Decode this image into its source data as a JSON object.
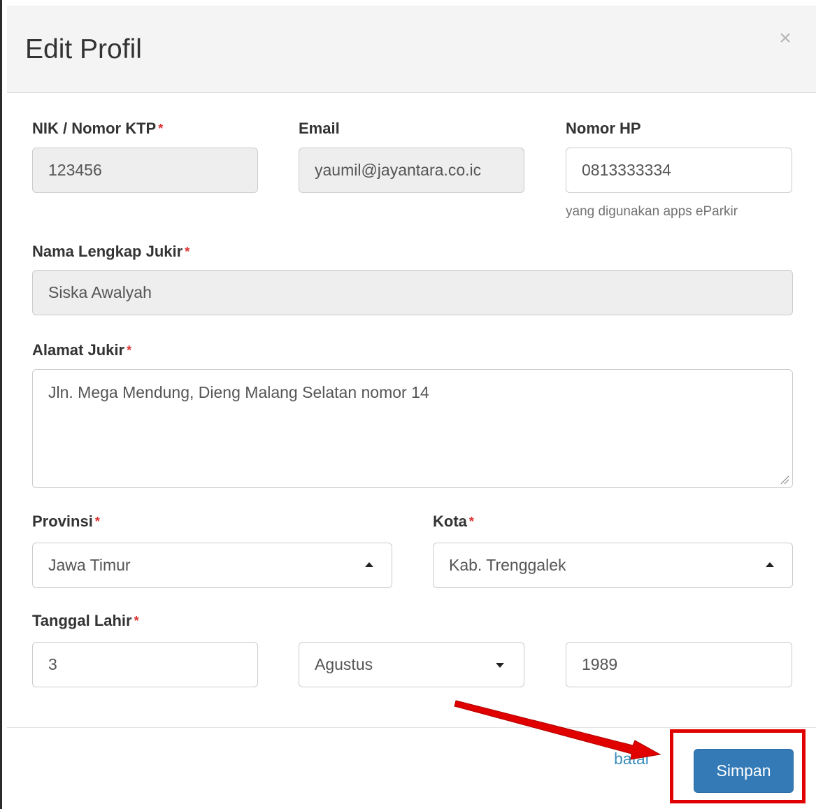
{
  "modal": {
    "title": "Edit Profil",
    "close_glyph": "×"
  },
  "fields": {
    "nik": {
      "label": "NIK / Nomor KTP",
      "required_mark": "*",
      "value": "123456"
    },
    "email": {
      "label": "Email",
      "value": "yaumil@jayantara.co.ic"
    },
    "phone": {
      "label": "Nomor HP",
      "value": "0813333334",
      "help": "yang digunakan apps eParkir"
    },
    "full_name": {
      "label": "Nama Lengkap Jukir",
      "required_mark": "*",
      "value": "Siska Awalyah"
    },
    "address": {
      "label": "Alamat Jukir",
      "required_mark": "*",
      "value": "Jln. Mega Mendung, Dieng Malang Selatan nomor 14"
    },
    "province": {
      "label": "Provinsi",
      "required_mark": "*",
      "value": "Jawa Timur"
    },
    "city": {
      "label": "Kota",
      "required_mark": "*",
      "value": "Kab. Trenggalek"
    },
    "birth_date": {
      "label": "Tanggal Lahir",
      "required_mark": "*",
      "day": "3",
      "month": "Agustus",
      "year": "1989"
    }
  },
  "footer": {
    "cancel_label": "batal",
    "save_label": "Simpan"
  },
  "colors": {
    "primary": "#337ab7",
    "link": "#3c8dbc",
    "required": "#dd3333",
    "annotation": "#e00000",
    "readonly_bg": "#eeeeee",
    "header_bg": "#f4f4f4"
  },
  "icons": {
    "close": "close-icon",
    "province_select": "caret-up-icon",
    "city_select": "caret-up-icon",
    "month_select": "caret-down-icon",
    "resize": "resize-grip-icon"
  }
}
